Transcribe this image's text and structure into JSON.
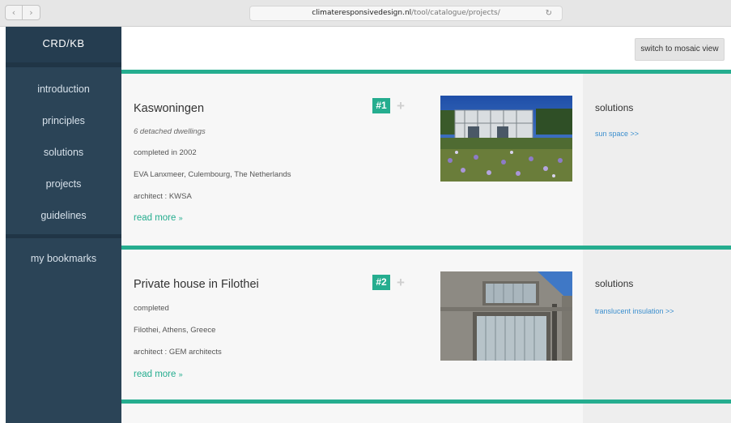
{
  "browser": {
    "back_label": "‹",
    "forward_label": "›",
    "url_host": "climateresponsivedesign.nl",
    "url_path": "/tool/catalogue/projects/",
    "reload_icon": "↻"
  },
  "sidebar": {
    "brand": "CRD/KB",
    "items": [
      {
        "label": "introduction"
      },
      {
        "label": "principles"
      },
      {
        "label": "solutions"
      },
      {
        "label": "projects"
      },
      {
        "label": "guidelines"
      }
    ],
    "bookmarks_label": "my bookmarks"
  },
  "toolbar": {
    "mosaic_label": "switch to mosaic view"
  },
  "projects": [
    {
      "title": "Kaswoningen",
      "subtitle": "6 detached dwellings",
      "completed": "completed in 2002",
      "location": "EVA Lanxmeer, Culembourg, The Netherlands",
      "architect": "architect : KWSA",
      "read_more": "read more",
      "read_more_arrow": "»",
      "number": "#1",
      "add_icon": "+",
      "solutions_heading": "solutions",
      "solution_link": "sun space >>"
    },
    {
      "title": "Private house in Filothei",
      "completed": "completed",
      "location": "Filothei, Athens, Greece",
      "architect": "architect : GEM architects",
      "read_more": "read more",
      "read_more_arrow": "»",
      "number": "#2",
      "add_icon": "+",
      "solutions_heading": "solutions",
      "solution_link": "translucent insulation >>"
    }
  ],
  "colors": {
    "accent": "#25ad8f",
    "sidebar": "#2b4457",
    "link": "#3c8fce"
  }
}
